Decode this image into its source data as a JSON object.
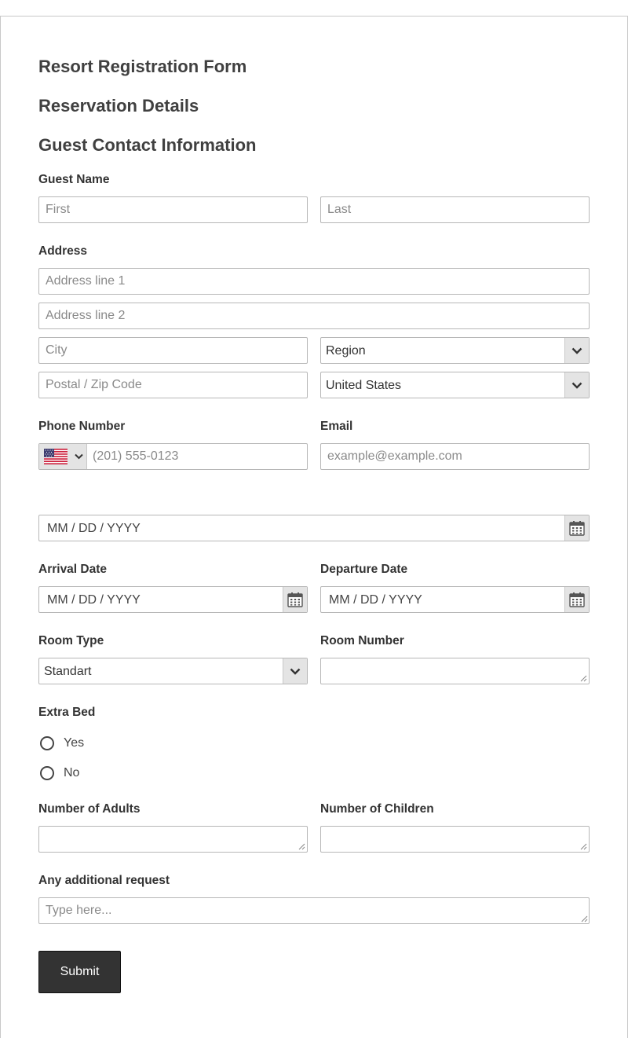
{
  "form": {
    "title": "Resort Registration Form",
    "section_reservation": "Reservation Details",
    "section_contact": "Guest Contact Information"
  },
  "guest_name": {
    "label": "Guest Name",
    "first_placeholder": "First",
    "last_placeholder": "Last"
  },
  "address": {
    "label": "Address",
    "line1_placeholder": "Address line 1",
    "line2_placeholder": "Address line 2",
    "city_placeholder": "City",
    "region_value": "Region",
    "postal_placeholder": "Postal / Zip Code",
    "country_value": "United States"
  },
  "phone": {
    "label": "Phone Number",
    "placeholder": "(201) 555-0123",
    "flag_icon": "us-flag-icon"
  },
  "email": {
    "label": "Email",
    "placeholder": "example@example.com"
  },
  "date_field": {
    "value": "MM / DD / YYYY"
  },
  "arrival": {
    "label": "Arrival Date",
    "value": "MM / DD / YYYY"
  },
  "departure": {
    "label": "Departure Date",
    "value": "MM / DD / YYYY"
  },
  "room_type": {
    "label": "Room Type",
    "value": "Standart"
  },
  "room_number": {
    "label": "Room Number"
  },
  "extra_bed": {
    "label": "Extra Bed",
    "options": [
      "Yes",
      "No"
    ]
  },
  "adults": {
    "label": "Number of Adults"
  },
  "children": {
    "label": "Number of Children"
  },
  "request": {
    "label": "Any additional request",
    "placeholder": "Type here..."
  },
  "submit_label": "Submit",
  "colors": {
    "button": "#333333",
    "caret_bg": "#e4e4e4",
    "border": "#b7b7b7"
  }
}
